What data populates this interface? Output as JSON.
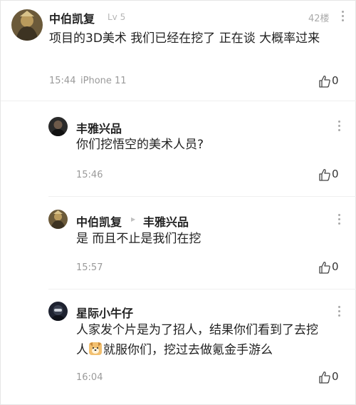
{
  "main_comment": {
    "username": "中伯凯复",
    "level": "Lv 5",
    "floor": "42楼",
    "text": "项目的3D美术 我们已经在挖了 正在谈 大概率过来",
    "time": "15:44",
    "device": "iPhone 11",
    "likes": "0"
  },
  "replies": [
    {
      "username": "丰雅兴品",
      "text": "你们挖悟空的美术人员?",
      "time": "15:46",
      "likes": "0"
    },
    {
      "username": "中伯凯复",
      "reply_to": "丰雅兴品",
      "text": "是 而且不止是我们在挖",
      "time": "15:57",
      "likes": "0"
    },
    {
      "username": "星际小牛仔",
      "text_line1": "人家发个片是为了招人，结果你们看到了去挖",
      "text_line2_a": "人",
      "text_line2_b": "就服你们，挖过去做氪金手游么",
      "time": "16:04",
      "likes": "0"
    }
  ],
  "icons": {
    "more": "more-vertical-icon",
    "like": "thumbs-up-icon",
    "emoji": "dog-face-emoji-icon",
    "reply_arrow": "triangle-right-icon"
  },
  "colors": {
    "text": "#222222",
    "meta": "#9a9a9a",
    "divider": "#efefef"
  }
}
